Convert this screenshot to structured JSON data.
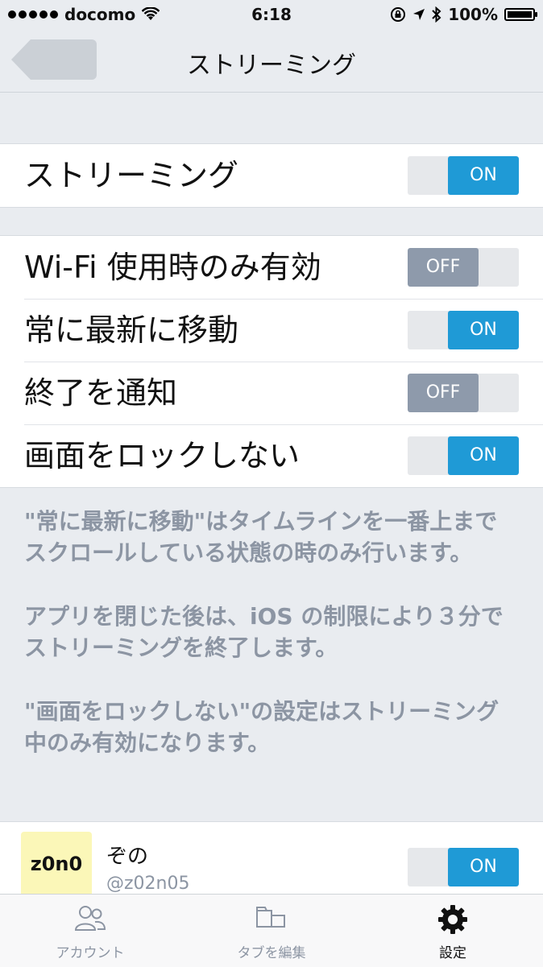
{
  "status_bar": {
    "carrier": "docomo",
    "time": "6:18",
    "battery_percent": "100%"
  },
  "nav": {
    "title": "ストリーミング"
  },
  "section1": {
    "rows": [
      {
        "label": "ストリーミング",
        "state": "ON"
      }
    ]
  },
  "section2": {
    "rows": [
      {
        "label": "Wi-Fi 使用時のみ有効",
        "state": "OFF"
      },
      {
        "label": "常に最新に移動",
        "state": "ON"
      },
      {
        "label": "終了を通知",
        "state": "OFF"
      },
      {
        "label": "画面をロックしない",
        "state": "ON"
      }
    ]
  },
  "notes": [
    "\"常に最新に移動\"はタイムラインを一番上までスクロールしている状態の時のみ行います。",
    "アプリを閉じた後は、iOS の制限により３分でストリーミングを終了します。",
    "\"画面をロックしない\"の設定はストリーミング中のみ有効になります。"
  ],
  "account": {
    "avatar_text": "z0n0",
    "name": "ぞの",
    "handle": "@z02n05",
    "state": "ON"
  },
  "tab_bar": {
    "tabs": [
      {
        "label": "アカウント",
        "icon": "accounts-icon"
      },
      {
        "label": "タブを編集",
        "icon": "edit-tabs-icon"
      },
      {
        "label": "設定",
        "icon": "gear-icon",
        "active": true
      }
    ]
  },
  "colors": {
    "toggle_on": "#1f9ad6",
    "toggle_off": "#8e9aab",
    "background": "#e9ecf0",
    "note_text": "#8c95a3"
  }
}
